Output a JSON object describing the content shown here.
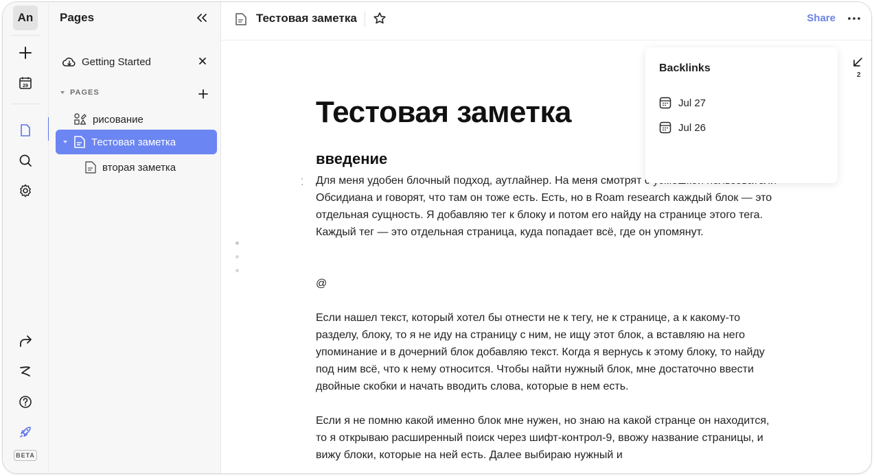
{
  "rail": {
    "avatar_initials": "An",
    "beta_label": "BETA",
    "icons": [
      "plus-icon",
      "calendar-icon",
      "page-icon",
      "search-icon",
      "gear-icon",
      "share-arrow-icon",
      "brand-logo-icon",
      "help-icon",
      "rocket-icon"
    ],
    "calendar_day": "29",
    "accent": "#5b73e8"
  },
  "panel": {
    "title": "Pages",
    "getting_started": "Getting Started",
    "section_label": "PAGES",
    "pages": [
      {
        "label": "рисование",
        "icon": "shapes-icon",
        "active": false,
        "level": 1
      },
      {
        "label": "Тестовая заметка",
        "icon": "page-icon",
        "active": true,
        "level": 1
      },
      {
        "label": "вторая заметка",
        "icon": "page-icon",
        "active": false,
        "level": 2
      }
    ],
    "active_color": "#6b85f2"
  },
  "topbar": {
    "doc_title": "Тестовая заметка",
    "share_label": "Share",
    "share_color": "#6a84e6"
  },
  "document": {
    "title": "Тестовая заметка",
    "heading": "введение",
    "paragraphs": [
      "Для меня удобен блочный подход, аутлайнер. На меня смотрят с усмешкой пользователи Обсидиана и говорят, что там он тоже есть. Есть, но в Roam research каждый блок — это отдельная сущность. Я добавляю тег к блоку и потом его найду на странице этого тега. Каждый тег — это отдельная страница, куда попадает всё, где он упомянут.",
      "@",
      "Если нашел текст, который хотел бы отнести не к тегу, не к странице, а к какому-то разделу, блоку, то я не иду на страницу с ним, не ищу этот блок, а вставляю на него упоминание и в дочерний блок добавляю текст. Когда я вернусь к этому блоку, то найду под ним всё, что к нему относится. Чтобы найти нужный блок, мне достаточно ввести двойные скобки и начать вводить слова, которые в нем есть.",
      "Если я не помню какой именно блок мне нужен, но знаю на какой странце он находится, то я открываю расширенный поиск через шифт-контрол-9, ввожу название страницы, и вижу блоки, которые на ней есть. Далее выбираю нужный и"
    ]
  },
  "backlinks": {
    "title": "Backlinks",
    "items": [
      {
        "label": "Jul 27",
        "icon": "calendar-icon"
      },
      {
        "label": "Jul 26",
        "icon": "calendar-icon"
      }
    ],
    "count": "2"
  }
}
